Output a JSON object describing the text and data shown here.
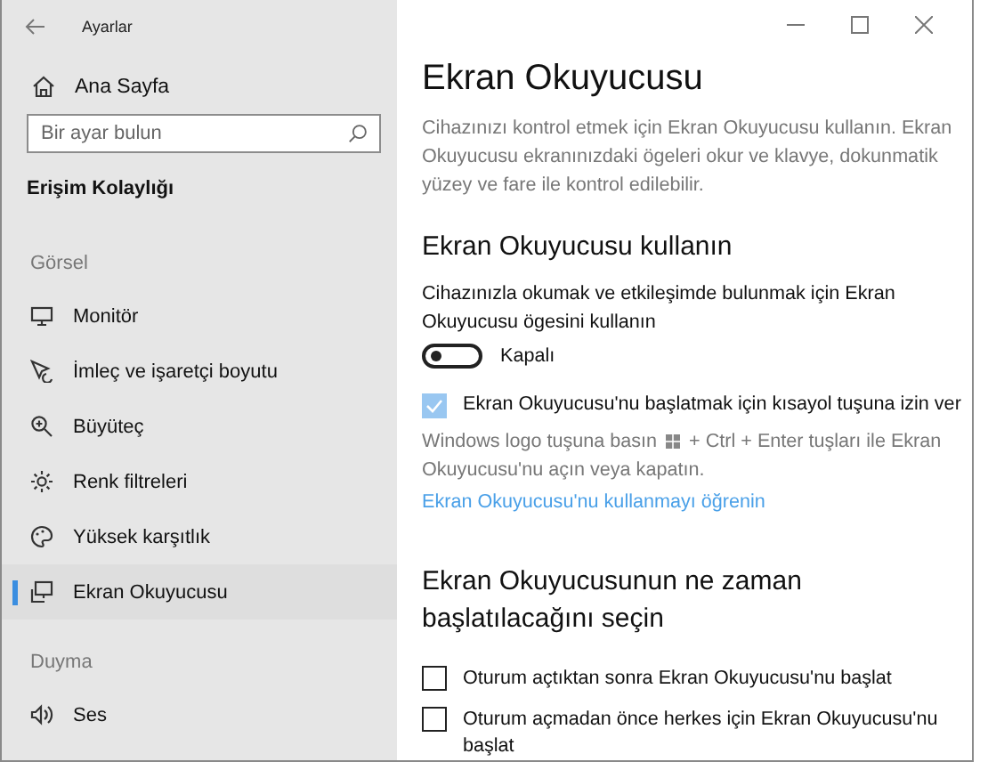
{
  "window": {
    "title": "Ayarlar"
  },
  "sidebar": {
    "home": "Ana Sayfa",
    "search": {
      "placeholder": "Bir ayar bulun"
    },
    "category": "Erişim Kolaylığı",
    "groups": [
      {
        "header": "Görsel",
        "items": [
          {
            "label": "Monitör",
            "selected": false
          },
          {
            "label": "İmleç ve işaretçi boyutu",
            "selected": false
          },
          {
            "label": "Büyüteç",
            "selected": false
          },
          {
            "label": "Renk filtreleri",
            "selected": false
          },
          {
            "label": "Yüksek karşıtlık",
            "selected": false
          },
          {
            "label": "Ekran Okuyucusu",
            "selected": true
          }
        ]
      },
      {
        "header": "Duyma",
        "items": [
          {
            "label": "Ses",
            "selected": false
          }
        ]
      }
    ]
  },
  "content": {
    "title": "Ekran Okuyucusu",
    "description": "Cihazınızı kontrol etmek için Ekran Okuyucusu kullanın. Ekran Okuyucusu ekranınızdaki ögeleri okur ve klavye, dokunmatik yüzey ve fare ile kontrol edilebilir.",
    "section1": {
      "heading": "Ekran Okuyucusu kullanın",
      "toggle_label": "Cihazınızla okumak ve etkileşimde bulunmak için Ekran Okuyucusu ögesini kullanın",
      "toggle": {
        "on": false,
        "state_text": "Kapalı"
      },
      "shortcut": {
        "label": "Ekran Okuyucusu'nu başlatmak için kısayol tuşuna izin ver",
        "checked": true
      },
      "hint_before": "Windows logo tuşuna basın",
      "hint_after_line1": "+ Ctrl + Enter tuşları ile Ekran",
      "hint_after_line2": "Okuyucusu'nu açın veya kapatın.",
      "link": "Ekran Okuyucusu'nu kullanmayı öğrenin"
    },
    "section2": {
      "heading": "Ekran Okuyucusunun ne zaman başlatılacağını seçin",
      "options": [
        {
          "label": "Oturum açtıktan sonra Ekran Okuyucusu'nu başlat",
          "checked": false
        },
        {
          "label": "Oturum açmadan önce herkes için Ekran Okuyucusu'nu başlat",
          "checked": false
        }
      ]
    }
  }
}
